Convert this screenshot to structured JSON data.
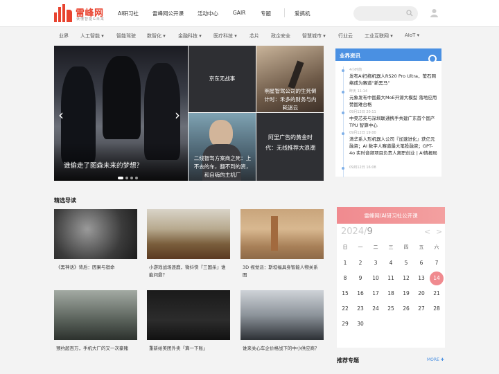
{
  "header": {
    "brand": "雷峰网",
    "tagline": "读懂智能&未来",
    "nav": [
      "AI研习社",
      "雷峰网公开课",
      "活动中心",
      "GAIR",
      "专题",
      "爱搞机"
    ]
  },
  "categories": [
    "业界",
    "人工智能",
    "智能驾驶",
    "数智化",
    "金融科技",
    "医疗科技",
    "芯片",
    "政企安全",
    "智慧城市",
    "行业云",
    "工业互联网",
    "AIoT"
  ],
  "hero": {
    "main_caption": "谁偷走了图森未来的梦想？",
    "tiles": [
      "京东无战事",
      "明星智驾公司的生死倒计时：禾多的财务与内耗迷云",
      "二线智驾方案商之死：上不去的车，翻不到的资，和自嗨的主机厂",
      "阿里广告的黄金时代：无线推荐大浪潮"
    ]
  },
  "industry_news": {
    "label": "业界资讯",
    "items": [
      {
        "time": "4小时前",
        "text": "发布AI扫拖机器人RS20 Pro Ultra，萤石网络成为赛道“新黑马”"
      },
      {
        "time": "昨天 11:14",
        "text": "元象发布中国最大MoE开源大模型 落地应用赞国难台格"
      },
      {
        "time": "09月12日 20:11",
        "text": "中昊芯英与深圳联通携手共建广东首个国产 TPU 智算中心"
      },
      {
        "time": "09月12日 19:00",
        "text": "清华系人形机器人公司『加速进化』获亿元融资；AI 数字人赛道最大笔投融资；GPT-4o 实时音频项目负责人离职创业 | AI情报局"
      },
      {
        "time": "09月12日 16:08",
        "text": ""
      }
    ]
  },
  "featured": {
    "title": "精选导读",
    "cards": [
      "《黑神话》背后：因果与宿命",
      "小游戏战场逐鹿，微抖快『三国杀』谁能问鼎？",
      "3D 视觉派：斯坦福具身智能人物关系图",
      "预约超百万，手机大厂的又一次豪赌",
      "重新给美团外卖「算一下账」",
      "谁来关心车企价格战下的中小供应商？"
    ]
  },
  "calendar": {
    "label": "雷峰网/AI研习社公开课",
    "year": "2024/",
    "month": "9",
    "prev": "<",
    "next": ">",
    "weekdays": [
      "日",
      "一",
      "二",
      "三",
      "四",
      "五",
      "六"
    ],
    "days": [
      "1",
      "2",
      "3",
      "4",
      "5",
      "6",
      "7",
      "8",
      "9",
      "10",
      "11",
      "12",
      "13",
      "14",
      "15",
      "16",
      "17",
      "18",
      "19",
      "20",
      "21",
      "22",
      "23",
      "24",
      "25",
      "26",
      "27",
      "28",
      "29",
      "30"
    ],
    "today": "14",
    "accent": "#f08a8f"
  },
  "recommend": {
    "title": "推荐专题",
    "more": "MORE"
  }
}
